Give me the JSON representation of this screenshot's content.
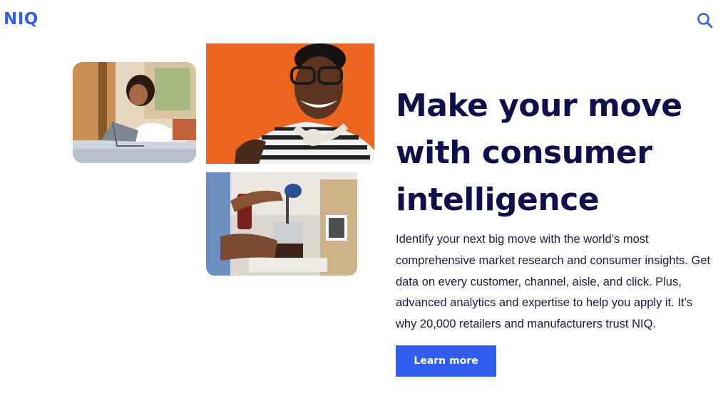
{
  "header": {
    "logo_text": "NIQ",
    "search_icon": "search-icon"
  },
  "images": {
    "laptop": "woman-using-laptop-photo",
    "smiling": "smiling-man-headphones-photo",
    "coffee": "coffee-press-fair-trade-photo"
  },
  "hero": {
    "title": "Make your move with consumer intelligence",
    "body": "Identify your next big move with the world’s most comprehensive market research and consumer insights. Get data on every customer, channel, aisle, and click. Plus, advanced analytics and expertise to help you apply it. It’s why 20,000 retailers and manufacturers trust NIQ.",
    "cta_label": "Learn more"
  },
  "colors": {
    "brand_blue": "#2f5ef0",
    "heading_navy": "#0f0f4b",
    "orange_wall": "#f06a22"
  }
}
